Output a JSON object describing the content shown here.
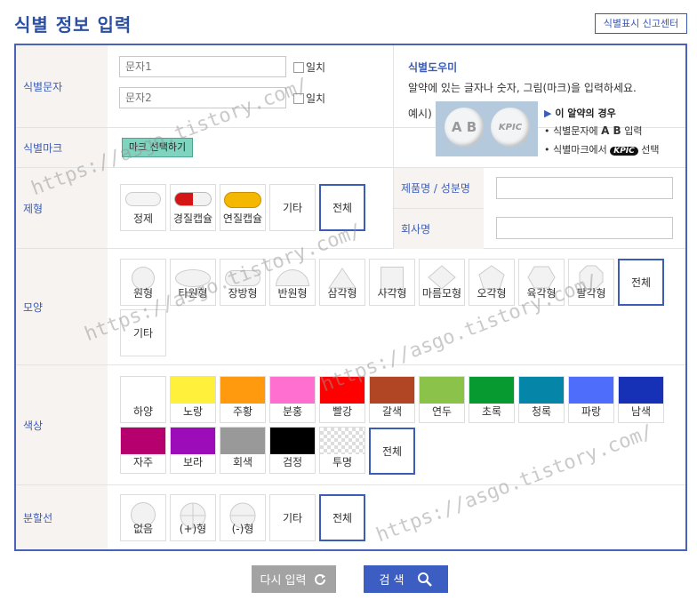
{
  "header": {
    "title": "식별 정보 입력",
    "report_button": "식별표시 신고센터"
  },
  "identifier": {
    "label": "식별문자",
    "field1_placeholder": "문자1",
    "field2_placeholder": "문자2",
    "match_label": "일치"
  },
  "mark": {
    "label": "식별마크",
    "button": "마크 선택하기"
  },
  "helper": {
    "title": "식별도우미",
    "description": "알약에 있는 글자나 숫자, 그림(마크)을 입력하세요.",
    "example_label": "예시)",
    "pill_text_left": "A B",
    "pill_text_right": "KPIC",
    "case_title": "이 알약의 경우",
    "line1_prefix": "• 식별문자에",
    "line1_bold": "A B",
    "line1_suffix": "입력",
    "line2_prefix": "• 식별마크에서",
    "line2_mark": "KPIC",
    "line2_suffix": "선택"
  },
  "form_type": {
    "label": "제형",
    "items": [
      "정제",
      "경질캡슐",
      "연질캡슐",
      "기타",
      "전체"
    ]
  },
  "product": {
    "product_label": "제품명 / 성분명",
    "company_label": "회사명"
  },
  "shape": {
    "label": "모양",
    "items": [
      "원형",
      "타원형",
      "장방형",
      "반원형",
      "삼각형",
      "사각형",
      "마름모형",
      "오각형",
      "육각형",
      "팔각형",
      "전체",
      "기타"
    ]
  },
  "color": {
    "label": "색상",
    "items": [
      {
        "name": "하양",
        "hex": "#ffffff"
      },
      {
        "name": "노랑",
        "hex": "#fff03c"
      },
      {
        "name": "주황",
        "hex": "#ff9a0e"
      },
      {
        "name": "분홍",
        "hex": "#ff6fd0"
      },
      {
        "name": "빨강",
        "hex": "#fe0000"
      },
      {
        "name": "갈색",
        "hex": "#b04624"
      },
      {
        "name": "연두",
        "hex": "#8bc34a"
      },
      {
        "name": "초록",
        "hex": "#079a30"
      },
      {
        "name": "청록",
        "hex": "#0586a8"
      },
      {
        "name": "파랑",
        "hex": "#4f6dfb"
      },
      {
        "name": "남색",
        "hex": "#1630b6"
      },
      {
        "name": "자주",
        "hex": "#b5006e"
      },
      {
        "name": "보라",
        "hex": "#9c0cb8"
      },
      {
        "name": "회색",
        "hex": "#999999"
      },
      {
        "name": "검정",
        "hex": "#000000"
      },
      {
        "name": "투명",
        "hex": "transparent"
      }
    ],
    "all_label": "전체"
  },
  "score": {
    "label": "분할선",
    "items": [
      "없음",
      "(+)형",
      "(-)형",
      "기타",
      "전체"
    ]
  },
  "actions": {
    "reset": "다시 입력",
    "search": "검 색"
  },
  "watermark": "https://asgo.tistory.com/"
}
